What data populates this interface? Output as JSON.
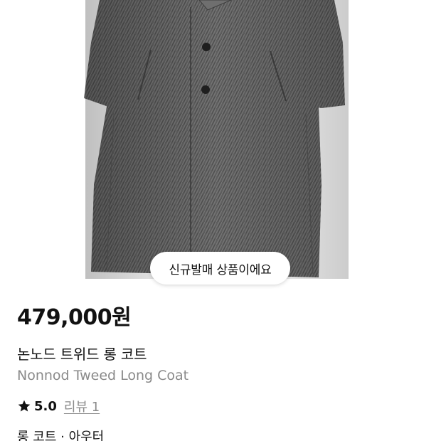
{
  "hero": {
    "image_name": "grey-herringbone-tweed-long-coat",
    "badge_label": "신규발매 상품이에요"
  },
  "product": {
    "price": "479,000원",
    "title_ko": "논노드 트위드 롱 코트",
    "title_en": "Nonnod Tweed Long Coat",
    "rating": "5.0",
    "review_label": "리뷰 1",
    "category": "롱 코트 · 아우터"
  },
  "colors": {
    "coat_grey": "#5f5f5f",
    "text_primary": "#111111",
    "text_secondary": "#8a8a8a"
  },
  "icons": {
    "rating_icon": "star-icon"
  }
}
